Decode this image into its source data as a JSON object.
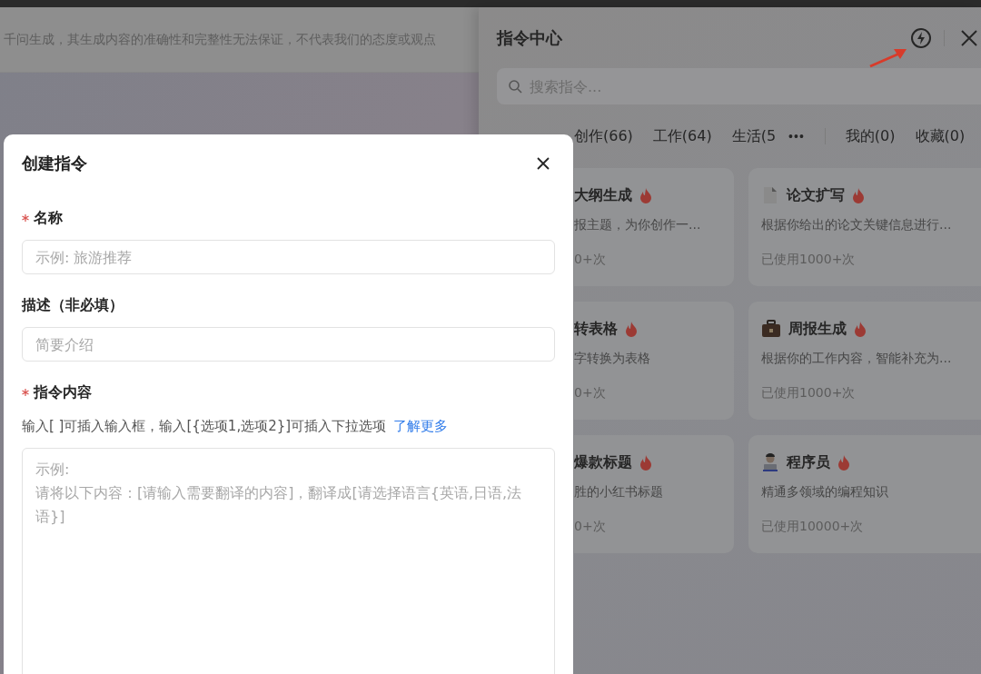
{
  "page": {
    "notice": "千问生成，其生成内容的准确性和完整性无法保证，不代表我们的态度或观点"
  },
  "drawer": {
    "title": "指令中心",
    "search": {
      "placeholder": "搜索指令..."
    },
    "tabs": [
      {
        "label": "创作(66)",
        "selected": false
      },
      {
        "label": "工作(64)",
        "selected": false
      },
      {
        "label": "生活(5",
        "selected": false
      }
    ],
    "more": "•••",
    "personal_tabs": [
      {
        "label": "我的(0)",
        "selected": false
      },
      {
        "label": "收藏(0)",
        "selected": false
      }
    ],
    "cards": [
      {
        "title": "大纲生成",
        "hot": true,
        "description": "报主题，为你创作一...",
        "usage": "0+次"
      },
      {
        "title": "论文扩写",
        "hot": true,
        "description": "根据你给出的论文关键信息进行...",
        "usage": "已使用1000+次"
      },
      {
        "title": "转表格",
        "hot": true,
        "description": "字转换为表格",
        "usage": "0+次"
      },
      {
        "title": "周报生成",
        "hot": true,
        "description": "根据你的工作内容，智能补充为...",
        "usage": "已使用1000+次"
      },
      {
        "title": "爆款标题",
        "hot": true,
        "description": "胜的小红书标题",
        "usage": "0+次"
      },
      {
        "title": "程序员",
        "hot": true,
        "description": "精通多领域的编程知识",
        "usage": "已使用10000+次"
      }
    ]
  },
  "modal": {
    "title": "创建指令",
    "fields": [
      {
        "kind": "input",
        "label": "名称",
        "required": true,
        "placeholder": "示例: 旅游推荐"
      },
      {
        "kind": "input",
        "label": "描述（非必填）",
        "required": false,
        "placeholder": "简要介绍"
      },
      {
        "kind": "textarea",
        "label": "指令内容",
        "required": true,
        "hint": "输入[ ]可插入输入框，输入[{选项1,选项2}]可插入下拉选项",
        "link": "了解更多",
        "placeholder": "示例:\n请将以下内容：[请输入需要翻译的内容]，翻译成[请选择语言{英语,日语,法语}]"
      }
    ]
  }
}
